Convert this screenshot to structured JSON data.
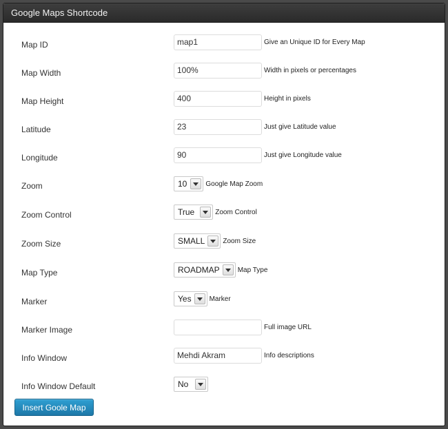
{
  "dialog": {
    "title": "Google Maps Shortcode"
  },
  "fields": {
    "map_id": {
      "label": "Map ID",
      "value": "map1",
      "help": "Give an Unique ID for Every Map"
    },
    "map_width": {
      "label": "Map Width",
      "value": "100%",
      "help": "Width in pixels or percentages"
    },
    "map_height": {
      "label": "Map Height",
      "value": "400",
      "help": "Height in pixels"
    },
    "latitude": {
      "label": "Latitude",
      "value": "23",
      "help": "Just give Latitude value"
    },
    "longitude": {
      "label": "Longitude",
      "value": "90",
      "help": "Just give Longitude value"
    },
    "zoom": {
      "label": "Zoom",
      "value": "10",
      "help": "Google Map Zoom"
    },
    "zoom_control": {
      "label": "Zoom Control",
      "value": "True",
      "help": "Zoom Control"
    },
    "zoom_size": {
      "label": "Zoom Size",
      "value": "SMALL",
      "help": "Zoom Size"
    },
    "map_type": {
      "label": "Map Type",
      "value": "ROADMAP",
      "help": "Map Type"
    },
    "marker": {
      "label": "Marker",
      "value": "Yes",
      "help": "Marker"
    },
    "marker_image": {
      "label": "Marker Image",
      "value": "",
      "help": "Full image URL"
    },
    "info_window": {
      "label": "Info Window",
      "value": "Mehdi Akram",
      "help": "Info descriptions"
    },
    "info_window_default": {
      "label": "Info Window Default",
      "value": "No"
    }
  },
  "actions": {
    "insert_label": "Insert Goole Map"
  },
  "icons": {
    "select_arrow": "chevron-down-icon"
  },
  "colors": {
    "titlebar": "#333333",
    "button": "#2488bd",
    "background": "#ffffff"
  }
}
